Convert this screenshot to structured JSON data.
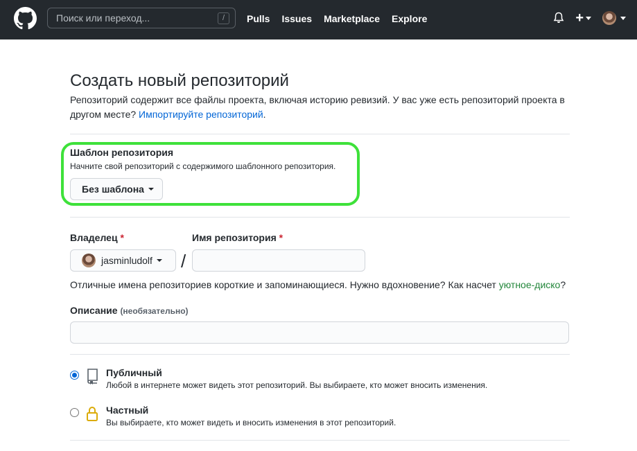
{
  "header": {
    "search_placeholder": "Поиск или переход...",
    "search_shortcut": "/",
    "nav": [
      "Pulls",
      "Issues",
      "Marketplace",
      "Explore"
    ],
    "plus_label": "+"
  },
  "page": {
    "title": "Создать новый репозиторий",
    "intro_text": "Репозиторий содержит все файлы проекта, включая историю ревизий. У вас уже есть репозиторий проекта в другом месте? ",
    "intro_link": "Импортируйте репозиторий",
    "intro_end": "."
  },
  "template": {
    "title": "Шаблон репозитория",
    "description": "Начните свой репозиторий с содержимого шаблонного репозитория.",
    "button_label": "Без шаблона"
  },
  "owner": {
    "label": "Владелец",
    "required_mark": "*",
    "value": "jasminludolf"
  },
  "repo_name": {
    "label": "Имя репозитория",
    "required_mark": "*",
    "value": "",
    "separator": "/"
  },
  "name_hint": {
    "text": "Отличные имена репозиториев короткие и запоминающиеся. Нужно вдохновение? Как насчет ",
    "suggestion": "уютное-диско",
    "end": "?"
  },
  "description": {
    "label": "Описание",
    "optional": "(необязательно)",
    "value": ""
  },
  "visibility": {
    "public": {
      "title": "Публичный",
      "description": "Любой в интернете может видеть этот репозиторий. Вы выбираете, кто может вносить изменения.",
      "selected": true,
      "icon": "repo-icon"
    },
    "private": {
      "title": "Частный",
      "description": "Вы выбираете, кто может видеть и вносить изменения в этот репозиторий.",
      "selected": false,
      "icon": "lock-icon"
    }
  },
  "colors": {
    "header_bg": "#24292e",
    "link": "#0366d6",
    "suggestion": "#22863a",
    "highlight": "#3ee13a",
    "required": "#cb2431"
  }
}
